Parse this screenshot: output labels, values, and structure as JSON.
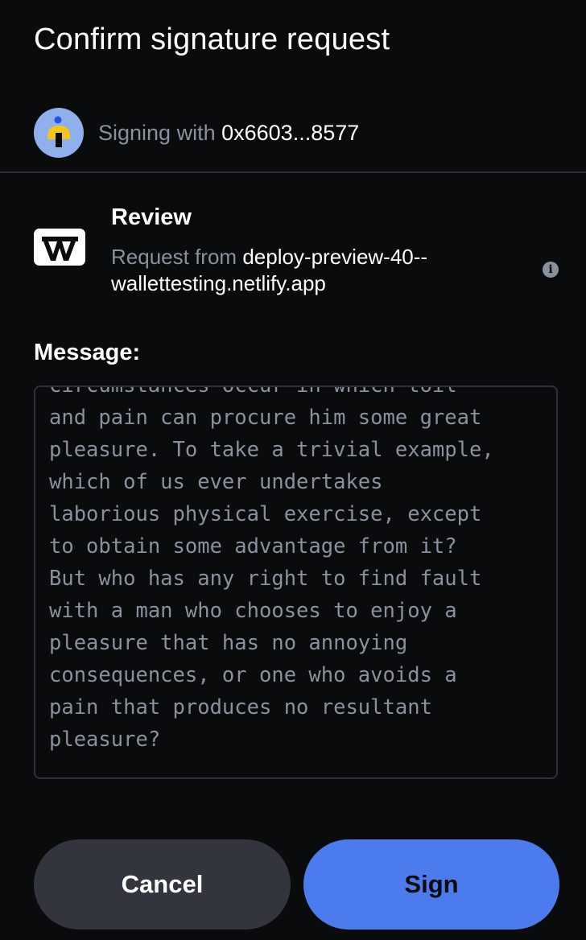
{
  "header": {
    "title": "Confirm signature request"
  },
  "signer": {
    "prefix": "Signing with",
    "address": "0x6603...8577",
    "avatar_icon": "person-avatar-icon"
  },
  "request": {
    "title": "Review",
    "from_label": "Request from",
    "origin": "deploy-preview-40--wallettesting.netlify.app",
    "logo_icon": "app-logo-icon",
    "info_icon": "info-icon"
  },
  "message": {
    "label": "Message:",
    "text": "circumstances occur in which toil\nand pain can procure him some great\npleasure. To take a trivial example,\nwhich of us ever undertakes\nlaborious physical exercise, except\nto obtain some advantage from it?\nBut who has any right to find fault\nwith a man who chooses to enjoy a\npleasure that has no annoying\nconsequences, or one who avoids a\npain that produces no resultant\npleasure?"
  },
  "actions": {
    "cancel_label": "Cancel",
    "sign_label": "Sign"
  },
  "colors": {
    "background": "#0a0b0d",
    "muted_text": "#8a919e",
    "primary": "#4b7bec",
    "secondary_button": "#32353d",
    "avatar_bg": "#8fb0ec"
  }
}
